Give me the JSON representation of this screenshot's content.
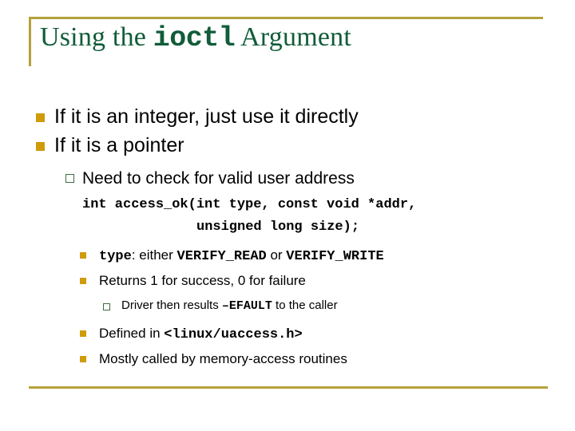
{
  "slide": {
    "accent_gold": "#b5a13a",
    "bullet_gold": "#cf9b09",
    "bullet_green": "#3f6b3f",
    "title_green": "#115c39",
    "title": {
      "part1": "Using the ",
      "code": "ioctl",
      "part2": " Argument"
    },
    "outline": {
      "b1_integer": "If it is an integer, just use it directly",
      "b2_pointer": "If it is a pointer",
      "b3_need_check": "Need to check for valid user address",
      "code_line1": "int access_ok(int type, const void *addr,",
      "code_line2": "unsigned long size);",
      "b4_type_mono": "type",
      "b4_type_mid": ": either ",
      "b4_verify_read": "VERIFY_READ",
      "b4_type_or": " or ",
      "b4_verify_write": "VERIFY_WRITE",
      "b5_returns": "Returns 1 for success, 0 for failure",
      "b6_driver_pre": "Driver then results ",
      "b6_driver_mono": "–EFAULT",
      "b6_driver_post": " to the caller",
      "b7_defined_pre": "Defined in ",
      "b7_defined_mono": "<linux/uaccess.h>",
      "b8_mostly": "Mostly called by memory-access routines"
    }
  }
}
